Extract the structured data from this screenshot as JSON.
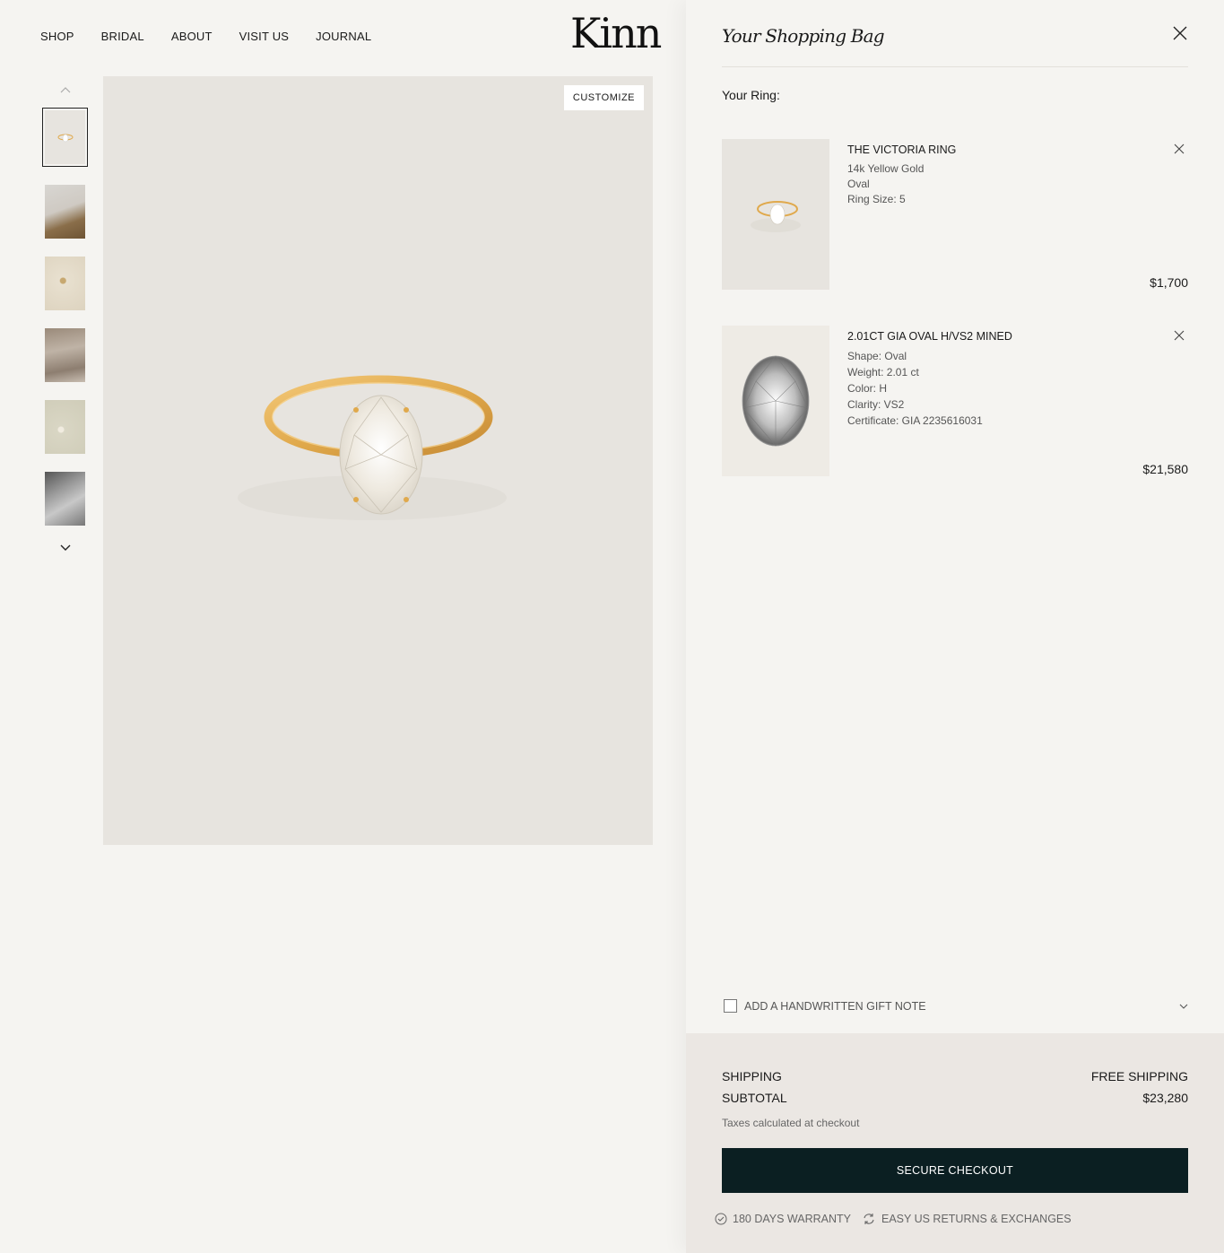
{
  "nav": {
    "items": [
      "SHOP",
      "BRIDAL",
      "ABOUT",
      "VISIT US",
      "JOURNAL"
    ]
  },
  "brand": {
    "logo_text": "Kinn"
  },
  "gallery": {
    "customize_label": "CUSTOMIZE",
    "thumbnail_count": 6,
    "active_index": 0
  },
  "bag": {
    "title": "Your Shopping Bag",
    "section_heading": "Your Ring:",
    "items": [
      {
        "title": "THE VICTORIA RING",
        "details": [
          "14k Yellow Gold",
          "Oval",
          "Ring Size:  5"
        ],
        "price": "$1,700"
      },
      {
        "title": "2.01CT GIA OVAL H/VS2 MINED",
        "details": [
          "Shape: Oval",
          "Weight: 2.01 ct",
          "Color: H",
          "Clarity: VS2",
          "Certificate: GIA 2235616031"
        ],
        "price": "$21,580"
      }
    ],
    "gift_note_label": "ADD A HANDWRITTEN GIFT NOTE",
    "shipping_label": "SHIPPING",
    "shipping_value": "FREE SHIPPING",
    "subtotal_label": "SUBTOTAL",
    "subtotal_value": "$23,280",
    "tax_note": "Taxes calculated at checkout",
    "checkout_label": "SECURE CHECKOUT",
    "perks": [
      "180 DAYS WARRANTY",
      "EASY US RETURNS & EXCHANGES"
    ]
  },
  "colors": {
    "page_bg": "#f5f4f1",
    "image_bg": "#e7e4df",
    "footer_bg": "#ebe7e3",
    "checkout_bg": "#0b1f22",
    "gold": "#e0a94c"
  }
}
